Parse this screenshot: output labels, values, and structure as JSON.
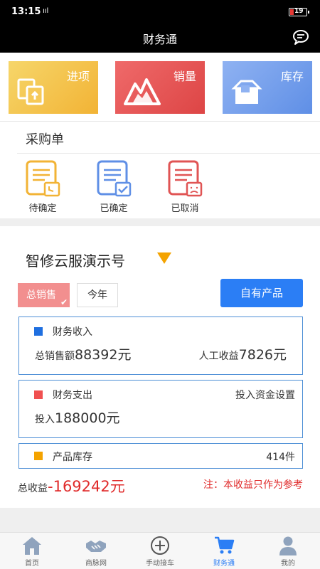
{
  "status_bar": {
    "time": "13:15",
    "signal_text": "ııl",
    "battery": "19"
  },
  "header": {
    "title": "财务通"
  },
  "tiles": [
    {
      "label": "进项",
      "color": "#f2b335"
    },
    {
      "label": "销量",
      "color": "#dd4545"
    },
    {
      "label": "库存",
      "color": "#5f8fe6"
    }
  ],
  "purchase": {
    "title": "采购单",
    "items": [
      {
        "label": "待确定",
        "icon": "pending-order-icon",
        "color": "#f2b335"
      },
      {
        "label": "已确定",
        "icon": "confirmed-order-icon",
        "color": "#5f8fe6"
      },
      {
        "label": "已取消",
        "icon": "cancelled-order-icon",
        "color": "#e05454"
      }
    ]
  },
  "finance": {
    "shop_name": "智修云服演示号",
    "filter_total": "总销售",
    "filter_year": "今年",
    "own_products": "自有产品",
    "income": {
      "title": "财务收入",
      "sales_label": "总销售额",
      "sales_value": "88392元",
      "labor_label": "人工收益",
      "labor_value": "7826元"
    },
    "expense": {
      "title": "财务支出",
      "setting": "投入资金设置",
      "invest_label": "投入",
      "invest_value": "188000元"
    },
    "inventory": {
      "title": "产品库存",
      "count": "414件"
    },
    "total_label": "总收益",
    "total_value": "-169242元",
    "note": "注：本收益只作为参考"
  },
  "nav": [
    {
      "label": "首页",
      "icon": "home-icon",
      "active": false
    },
    {
      "label": "商脉网",
      "icon": "handshake-icon",
      "active": false
    },
    {
      "label": "手动接车",
      "icon": "add-circle-icon",
      "active": false
    },
    {
      "label": "财务通",
      "icon": "cart-icon",
      "active": true
    },
    {
      "label": "我的",
      "icon": "person-icon",
      "active": false
    }
  ]
}
